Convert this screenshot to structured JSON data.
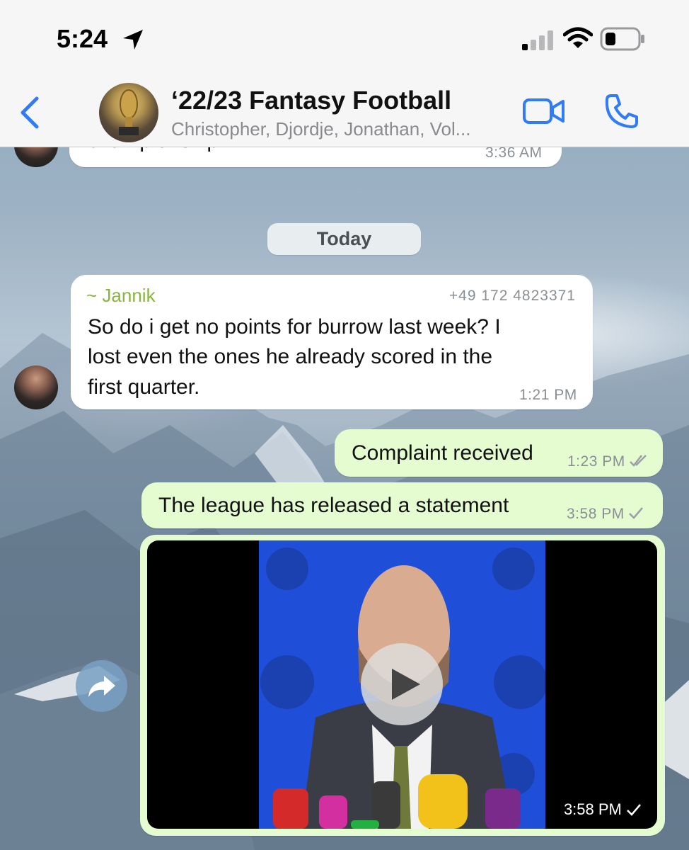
{
  "status_bar": {
    "time": "5:24"
  },
  "header": {
    "title": "‘22/23 Fantasy Football",
    "members": "Christopher, Djordje, Jonathan, Vol..."
  },
  "messages": {
    "prev": {
      "text": "championship!",
      "time": "3:36 AM"
    },
    "date_separator": "Today",
    "jannik": {
      "sender": "~ Jannik",
      "phone": "+49 172 4823371",
      "line1": "So do i get no points for burrow last week? I",
      "line2": "lost even the ones he already scored in the",
      "line3": "first quarter.",
      "time": "1:21 PM"
    },
    "out1": {
      "text": "Complaint received",
      "time": "1:23 PM"
    },
    "out2": {
      "text": "The league has released a statement",
      "time": "3:58 PM"
    },
    "video": {
      "time": "3:58 PM"
    }
  },
  "colors": {
    "accent": "#2f7cf6",
    "outgoing_bubble": "#e5fbd0",
    "sender_name": "#8ab53c"
  },
  "icons": [
    "location-arrow-icon",
    "signal-icon",
    "wifi-icon",
    "battery-icon",
    "back-chevron-icon",
    "video-call-icon",
    "phone-icon",
    "play-icon",
    "forward-icon",
    "double-check-icon",
    "check-icon"
  ]
}
